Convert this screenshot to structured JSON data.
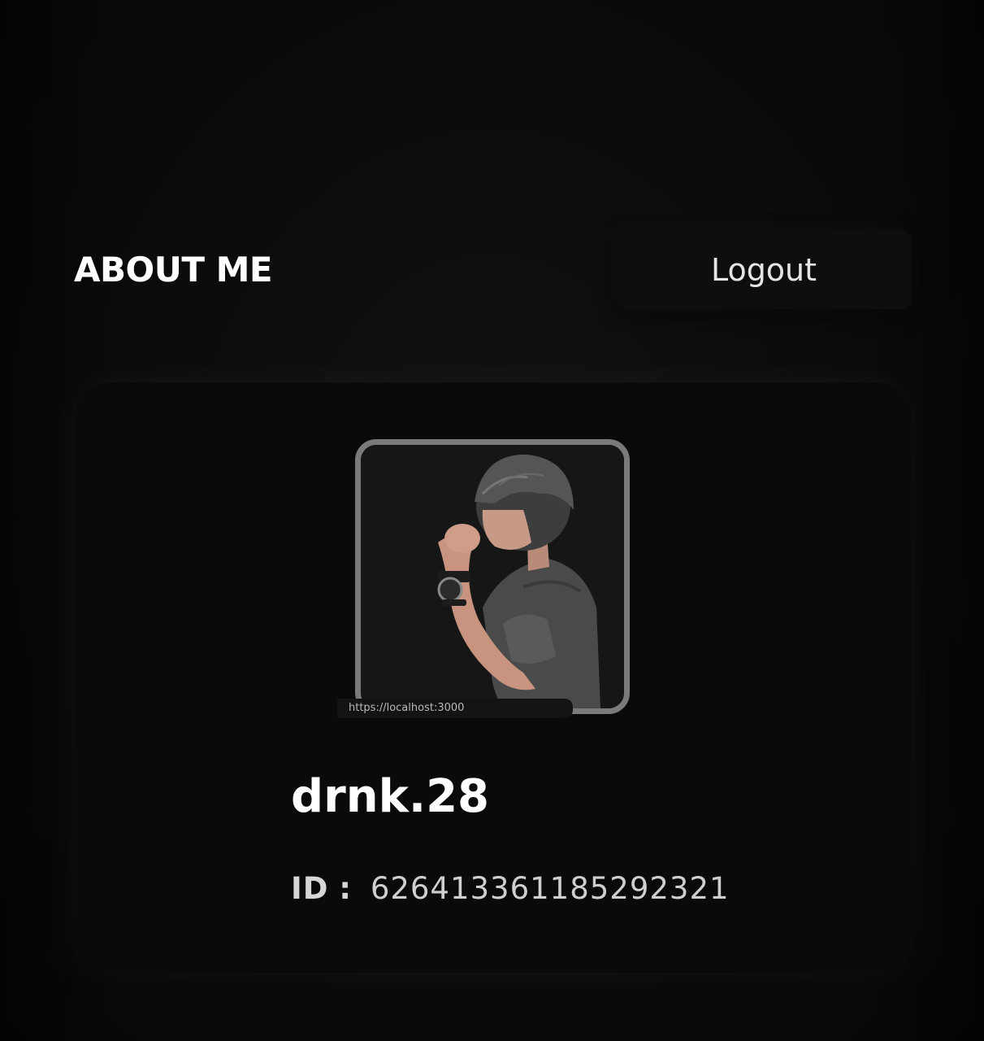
{
  "header": {
    "title": "ABOUT ME",
    "logout_label": "Logout"
  },
  "profile": {
    "avatar_icon": "profile-photo",
    "username": "drnk.28",
    "id_label": "ID",
    "id_separator": ":",
    "id_value": "626413361185292321"
  },
  "status_bar": {
    "url": "https://localhost:3000"
  },
  "colors": {
    "background": "#0b0b0b",
    "card": "#0a0a0a",
    "avatar_border": "#7a7a7a",
    "text_primary": "#ffffff",
    "text_secondary": "#cfcfcf"
  }
}
